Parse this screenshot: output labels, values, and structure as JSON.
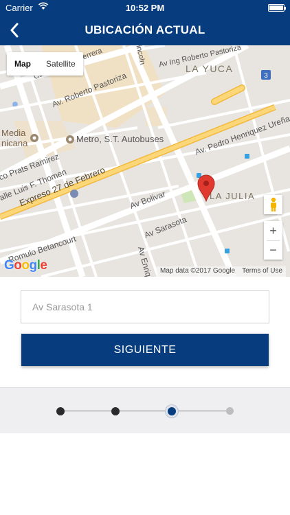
{
  "status_bar": {
    "carrier": "Carrier",
    "time": "10:52 PM"
  },
  "nav": {
    "title": "UBICACIÓN ACTUAL",
    "back_icon": "chevron-left-icon"
  },
  "map": {
    "map_type": {
      "map": "Map",
      "satellite": "Satellite"
    },
    "labels": {
      "herrera": "Herrera",
      "ing_roberto": "Av Ing Roberto Pastoriza",
      "la_yuca": "LA YUCA",
      "av_roberto": "Av. Roberto Pastoriza",
      "media": "Media",
      "nicana": "nicana",
      "metro": "Metro, S.T. Autobuses",
      "pedro": "Av. Pedro Henriquez Ureña",
      "prats": "co Prats Ramirez",
      "thomen": "alle Luis F. Thomen",
      "expreso": "Expreso 27 de Febrero",
      "bolivar": "Av Bolivar",
      "la_julia": "LA JULIA",
      "sarasota": "Av Sarasota",
      "betancourt": "Romulo Betancourt",
      "enriq": "Av Enriq",
      "lincoln": "incoln",
      "highway_badge": "3",
      "ca": "Ca"
    },
    "google_logo": "Google",
    "attribution": {
      "data": "Map data ©2017 Google",
      "terms": "Terms of Use"
    },
    "zoom": {
      "in": "+",
      "out": "−"
    },
    "colors": {
      "pin": "#e03a30",
      "roads": "#ffffff",
      "highway": "#f6c75a",
      "block": "#e9e6e1",
      "area": "#f3e2c7"
    }
  },
  "form": {
    "address_placeholder": "Av Sarasota 1",
    "next_label": "SIGUIENTE"
  },
  "stepper": {
    "total_steps": 4,
    "current_step": 3
  },
  "theme": {
    "primary": "#073d7f"
  }
}
